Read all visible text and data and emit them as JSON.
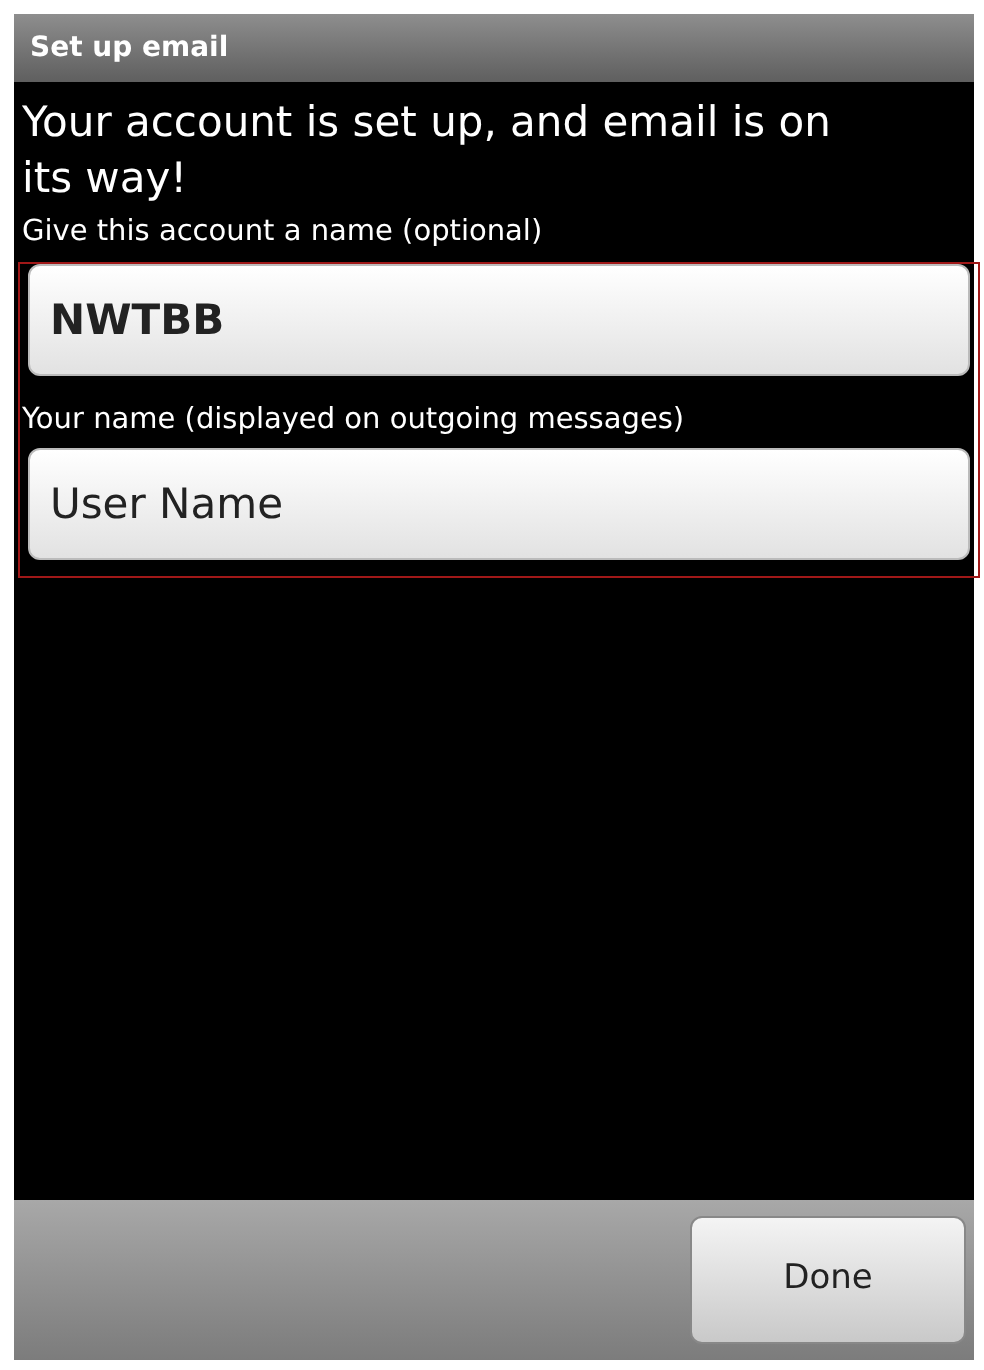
{
  "title_bar": {
    "title": "Set up email"
  },
  "message": "Your account is set up, and email is on its way!",
  "fields": [
    {
      "label": "Give this account a name (optional)",
      "value": "NWTBB",
      "bold": true
    },
    {
      "label": "Your name (displayed on outgoing messages)",
      "value": "User Name",
      "bold": false
    }
  ],
  "bottom_bar": {
    "button": "Done"
  }
}
